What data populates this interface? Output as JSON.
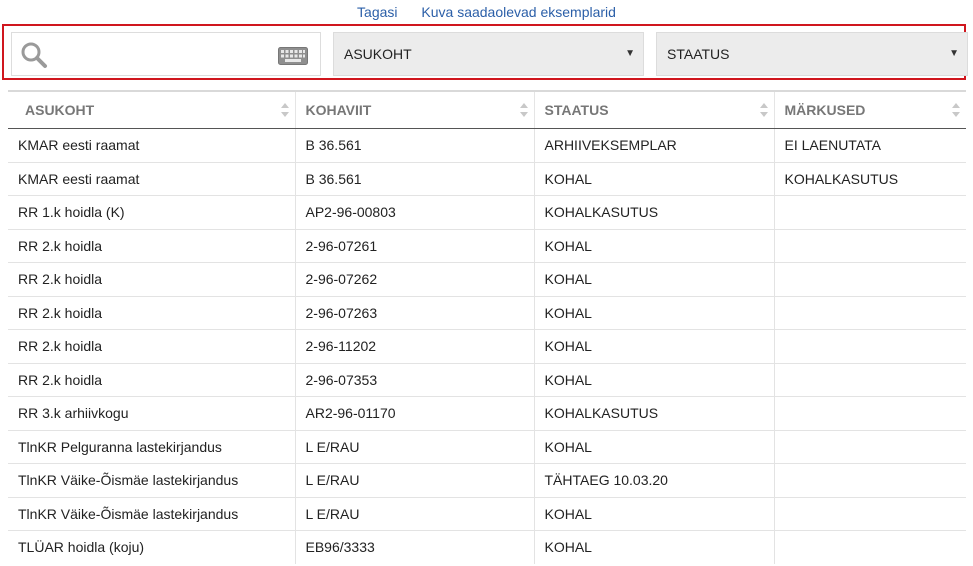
{
  "nav": {
    "back_label": "Tagasi",
    "available_label": "Kuva saadaolevad eksemplarid"
  },
  "filters": {
    "search_placeholder": "",
    "location_select": "ASUKOHT",
    "status_select": "STAATUS"
  },
  "table": {
    "headers": [
      "ASUKOHT",
      "KOHAVIIT",
      "STAATUS",
      "MÄRKUSED"
    ],
    "rows": [
      {
        "location": "KMAR eesti raamat",
        "call_no": "B 36.561",
        "status": "ARHIIVEKSEMPLAR",
        "notes": "EI LAENUTATA",
        "location_link": false
      },
      {
        "location": "KMAR eesti raamat",
        "call_no": "B 36.561",
        "status": "KOHAL",
        "notes": "KOHALKASUTUS",
        "location_link": false
      },
      {
        "location": "RR 1.k hoidla (K)",
        "call_no": "AP2-96-00803",
        "status": "KOHALKASUTUS",
        "notes": "",
        "location_link": false
      },
      {
        "location": "RR 2.k hoidla",
        "call_no": "2-96-07261",
        "status": "KOHAL",
        "notes": "",
        "location_link": false
      },
      {
        "location": "RR 2.k hoidla",
        "call_no": "2-96-07262",
        "status": "KOHAL",
        "notes": "",
        "location_link": false
      },
      {
        "location": "RR 2.k hoidla",
        "call_no": "2-96-07263",
        "status": "KOHAL",
        "notes": "",
        "location_link": false
      },
      {
        "location": "RR 2.k hoidla",
        "call_no": "2-96-11202",
        "status": "KOHAL",
        "notes": "",
        "location_link": false
      },
      {
        "location": "RR 2.k hoidla",
        "call_no": "2-96-07353",
        "status": "KOHAL",
        "notes": "",
        "location_link": false
      },
      {
        "location": "RR 3.k arhiivkogu",
        "call_no": "AR2-96-01170",
        "status": "KOHALKASUTUS",
        "notes": "",
        "location_link": false
      },
      {
        "location": "TlnKR Pelguranna lastekirjandus",
        "call_no": "L E/RAU",
        "status": "KOHAL",
        "notes": "",
        "location_link": true
      },
      {
        "location": "TlnKR Väike-Õismäe lastekirjandus",
        "call_no": "L E/RAU",
        "status": "TÄHTAEG 10.03.20",
        "notes": "",
        "location_link": true
      },
      {
        "location": "TlnKR Väike-Õismäe lastekirjandus",
        "call_no": "L E/RAU",
        "status": "KOHAL",
        "notes": "",
        "location_link": true
      },
      {
        "location": "TLÜAR hoidla (koju)",
        "call_no": "EB96/3333",
        "status": "KOHAL",
        "notes": "",
        "location_link": true
      }
    ]
  },
  "colors": {
    "link": "#2b5fa8",
    "highlight_border": "#d0161e",
    "select_bg": "#ececec"
  }
}
